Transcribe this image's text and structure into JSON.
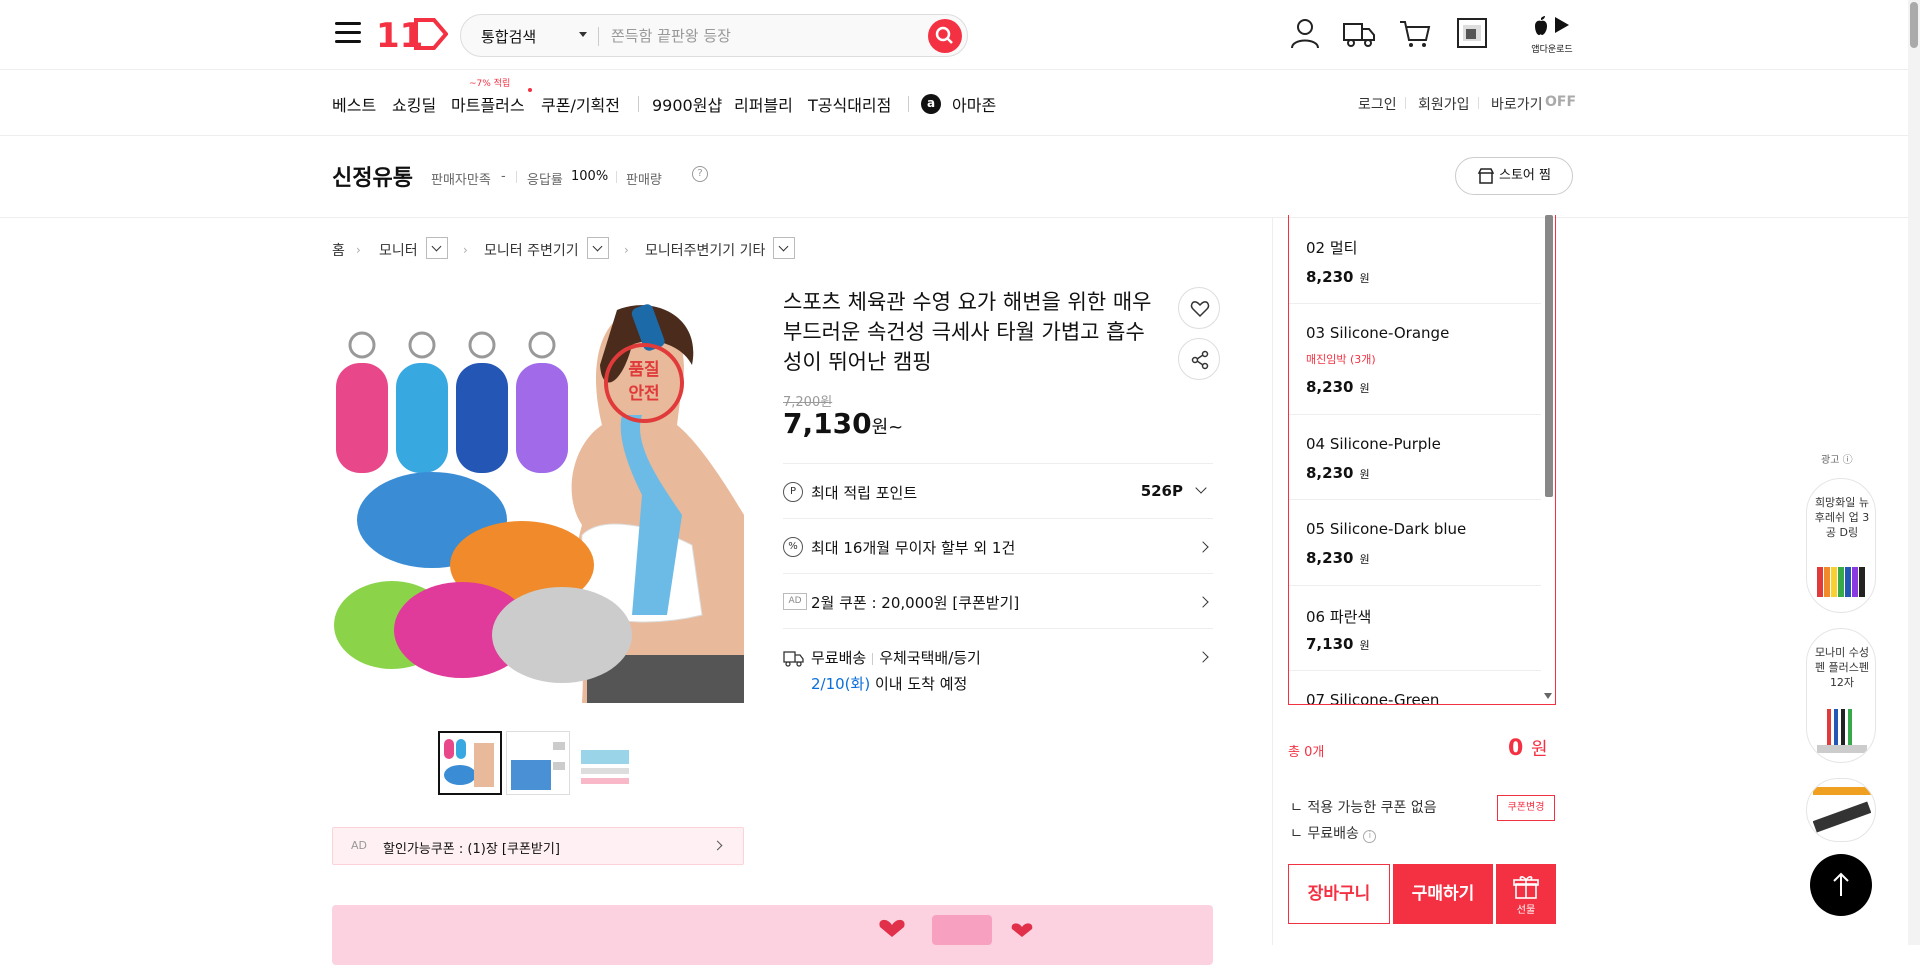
{
  "header": {
    "search_scope": "통합검색",
    "search_placeholder": "쫀득함 끝판왕 등장",
    "app_download": "앱다운로드"
  },
  "nav": {
    "items": [
      "베스트",
      "쇼킹딜",
      "마트플러스",
      "쿠폰/기획전",
      "9900원샵",
      "리퍼블리",
      "T공식대리점",
      "아마존"
    ],
    "mart_badge": "~7% 적립",
    "util": [
      "로그인",
      "회원가입",
      "바로가기"
    ],
    "shortcut_state": "OFF",
    "amazon_mark": "a"
  },
  "store": {
    "name": "신정유통",
    "seller_satisfaction_label": "판매자만족",
    "seller_satisfaction_value": "-",
    "response_label": "응답률",
    "response_value": "100%",
    "sales_label": "판매량",
    "help": "?",
    "follow": "스토어 찜"
  },
  "breadcrumb": [
    "홈",
    "모니터",
    "모니터 주변기기",
    "모니터주변기기 기타"
  ],
  "product": {
    "title": "스포츠 체육관 수영 요가 해변을 위한 매우 부드러운 속건성 극세사 타월 가볍고 흡수성이 뛰어난 캠핑",
    "original_price": "7,200원",
    "price": "7,130",
    "price_suffix": "원~",
    "stamp": "품질안전",
    "points_label": "최대 적립 포인트",
    "points_value": "526P",
    "installment_label": "최대 16개월 무이자 할부 외 1건",
    "coupon_ad": "AD",
    "coupon_label": "2월 쿠폰 : 20,000원 [쿠폰받기]",
    "shipping_free": "무료배송",
    "shipping_method": "우체국택배/등기",
    "arrival_date": "2/10(화)",
    "arrival_text": " 이내 도착 예정",
    "discount_coupon_ad": "AD",
    "discount_coupon": "할인가능쿠폰 : (1)장 [쿠폰받기]"
  },
  "options": [
    {
      "name": "02 멀티",
      "price": "8,230",
      "unit": "원",
      "warn": ""
    },
    {
      "name": "03 Silicone-Orange",
      "price": "8,230",
      "unit": "원",
      "warn": "매진임박 (3개)"
    },
    {
      "name": "04 Silicone-Purple",
      "price": "8,230",
      "unit": "원",
      "warn": ""
    },
    {
      "name": "05 Silicone-Dark blue",
      "price": "8,230",
      "unit": "원",
      "warn": ""
    },
    {
      "name": "06 파란색",
      "price": "7,130",
      "unit": "원",
      "warn": ""
    },
    {
      "name": "07 Silicone-Green",
      "price": "",
      "unit": "",
      "warn": ""
    }
  ],
  "summary": {
    "total_label": "총 0개",
    "total_value": "0",
    "total_unit": "원",
    "coupon_none": "적용 가능한 쿠폰 없음",
    "coupon_change": "쿠폰변경",
    "free_shipping": "무료배송",
    "cart": "장바구니",
    "buy": "구매하기",
    "gift": "선물"
  },
  "side_ads": {
    "label": "광고",
    "cards": [
      "희망화일 뉴 후레쉬 업 3공 D링",
      "모나미 수성펜 플러스펜 12자"
    ]
  },
  "colors": {
    "brand": "#f43142",
    "link": "#0b6fd9"
  }
}
